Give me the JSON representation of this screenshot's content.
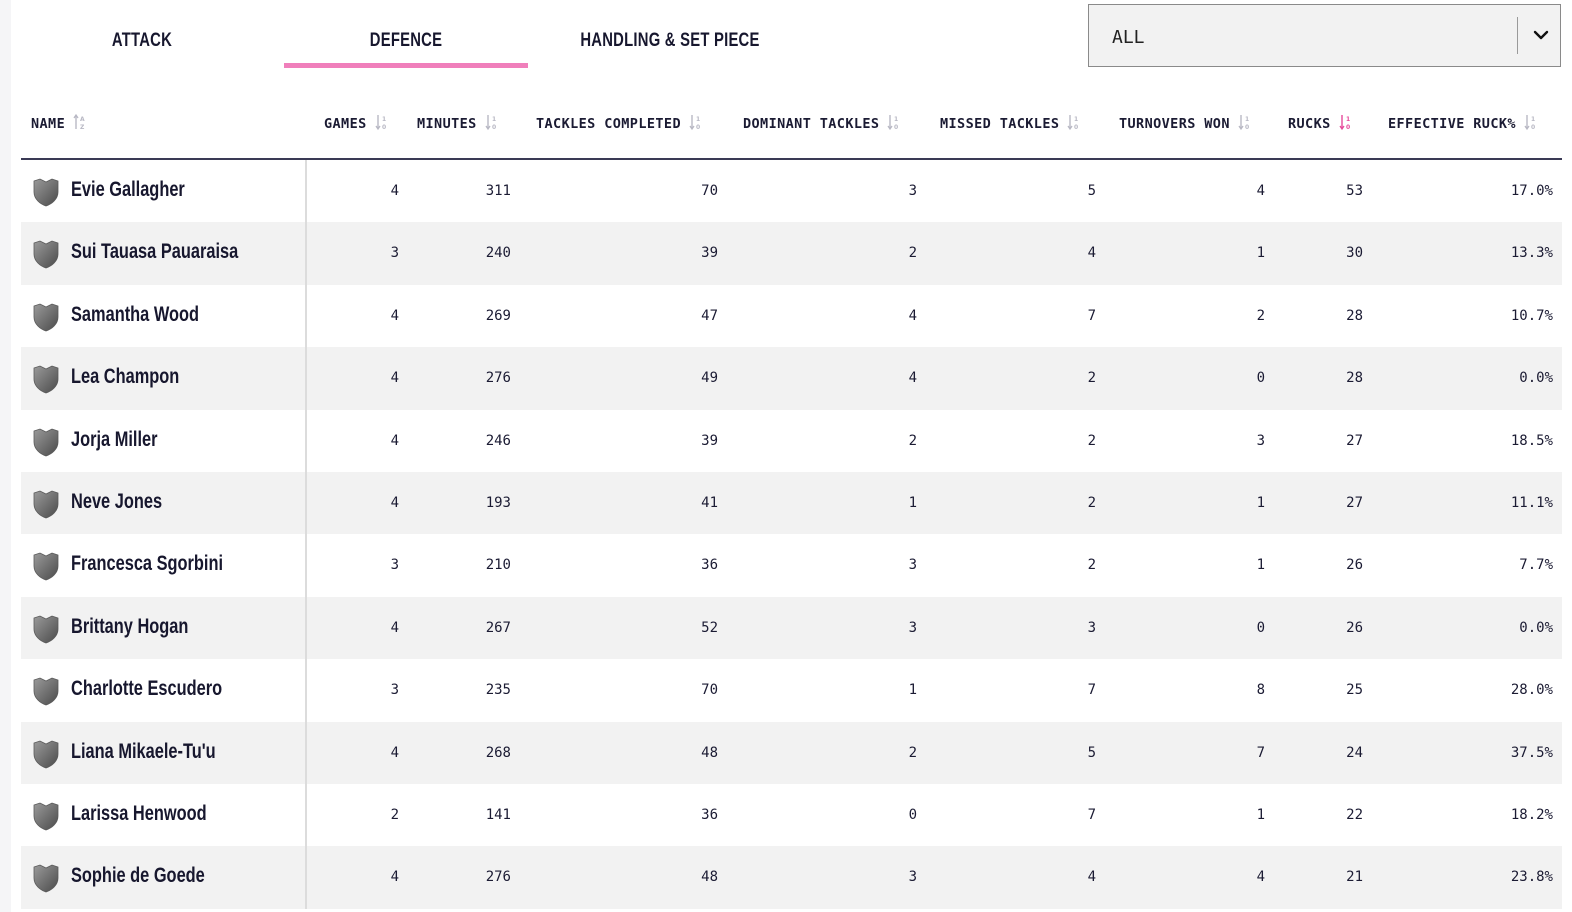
{
  "tabs": [
    {
      "label": "ATTACK"
    },
    {
      "label": "DEFENCE"
    },
    {
      "label": "HANDLING & SET PIECE"
    }
  ],
  "active_tab": "DEFENCE",
  "filter": {
    "value": "ALL"
  },
  "columns": [
    {
      "label": "NAME"
    },
    {
      "label": "GAMES"
    },
    {
      "label": "MINUTES"
    },
    {
      "label": "TACKLES COMPLETED"
    },
    {
      "label": "DOMINANT TACKLES"
    },
    {
      "label": "MISSED TACKLES"
    },
    {
      "label": "TURNOVERS WON"
    },
    {
      "label": "RUCKS"
    },
    {
      "label": "EFFECTIVE RUCK%"
    }
  ],
  "sorted_column": "RUCKS",
  "colors": {
    "accent": "#f07fbb",
    "text": "#17172e",
    "row_alt": "#f2f2f2"
  },
  "rows": [
    {
      "name": "Evie Gallagher",
      "games": "4",
      "minutes": "311",
      "tackles_completed": "70",
      "dominant_tackles": "3",
      "missed_tackles": "5",
      "turnovers_won": "4",
      "rucks": "53",
      "effective_ruck": "17.0%"
    },
    {
      "name": "Sui Tauasa Pauaraisa",
      "games": "3",
      "minutes": "240",
      "tackles_completed": "39",
      "dominant_tackles": "2",
      "missed_tackles": "4",
      "turnovers_won": "1",
      "rucks": "30",
      "effective_ruck": "13.3%"
    },
    {
      "name": "Samantha Wood",
      "games": "4",
      "minutes": "269",
      "tackles_completed": "47",
      "dominant_tackles": "4",
      "missed_tackles": "7",
      "turnovers_won": "2",
      "rucks": "28",
      "effective_ruck": "10.7%"
    },
    {
      "name": "Lea Champon",
      "games": "4",
      "minutes": "276",
      "tackles_completed": "49",
      "dominant_tackles": "4",
      "missed_tackles": "2",
      "turnovers_won": "0",
      "rucks": "28",
      "effective_ruck": "0.0%"
    },
    {
      "name": "Jorja Miller",
      "games": "4",
      "minutes": "246",
      "tackles_completed": "39",
      "dominant_tackles": "2",
      "missed_tackles": "2",
      "turnovers_won": "3",
      "rucks": "27",
      "effective_ruck": "18.5%"
    },
    {
      "name": "Neve Jones",
      "games": "4",
      "minutes": "193",
      "tackles_completed": "41",
      "dominant_tackles": "1",
      "missed_tackles": "2",
      "turnovers_won": "1",
      "rucks": "27",
      "effective_ruck": "11.1%"
    },
    {
      "name": "Francesca Sgorbini",
      "games": "3",
      "minutes": "210",
      "tackles_completed": "36",
      "dominant_tackles": "3",
      "missed_tackles": "2",
      "turnovers_won": "1",
      "rucks": "26",
      "effective_ruck": "7.7%"
    },
    {
      "name": "Brittany Hogan",
      "games": "4",
      "minutes": "267",
      "tackles_completed": "52",
      "dominant_tackles": "3",
      "missed_tackles": "3",
      "turnovers_won": "0",
      "rucks": "26",
      "effective_ruck": "0.0%"
    },
    {
      "name": "Charlotte Escudero",
      "games": "3",
      "minutes": "235",
      "tackles_completed": "70",
      "dominant_tackles": "1",
      "missed_tackles": "7",
      "turnovers_won": "8",
      "rucks": "25",
      "effective_ruck": "28.0%"
    },
    {
      "name": "Liana Mikaele-Tu'u",
      "games": "4",
      "minutes": "268",
      "tackles_completed": "48",
      "dominant_tackles": "2",
      "missed_tackles": "5",
      "turnovers_won": "7",
      "rucks": "24",
      "effective_ruck": "37.5%"
    },
    {
      "name": "Larissa Henwood",
      "games": "2",
      "minutes": "141",
      "tackles_completed": "36",
      "dominant_tackles": "0",
      "missed_tackles": "7",
      "turnovers_won": "1",
      "rucks": "22",
      "effective_ruck": "18.2%"
    },
    {
      "name": "Sophie de Goede",
      "games": "4",
      "minutes": "276",
      "tackles_completed": "48",
      "dominant_tackles": "3",
      "missed_tackles": "4",
      "turnovers_won": "4",
      "rucks": "21",
      "effective_ruck": "23.8%"
    }
  ]
}
